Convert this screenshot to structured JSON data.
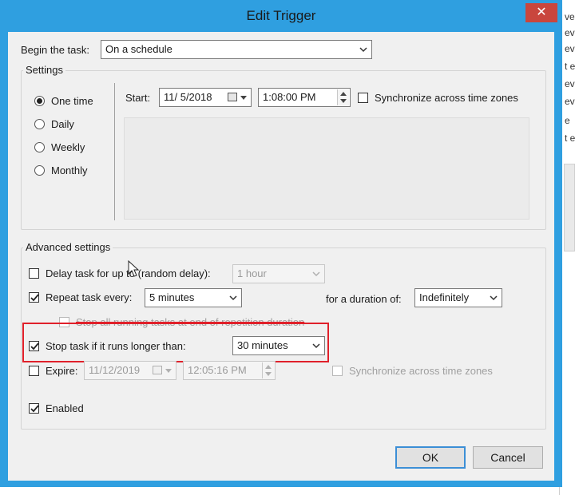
{
  "dialog": {
    "title": "Edit Trigger",
    "close_glyph": "✕"
  },
  "background_window": {
    "lines": [
      "ve",
      "eve",
      "eve",
      "t e",
      "eve",
      "eve",
      "e",
      "t e"
    ]
  },
  "begin_task": {
    "label": "Begin the task:",
    "value": "On a schedule"
  },
  "settings": {
    "group_label": "Settings",
    "radios": [
      {
        "label": "One time",
        "checked": true
      },
      {
        "label": "Daily",
        "checked": false
      },
      {
        "label": "Weekly",
        "checked": false
      },
      {
        "label": "Monthly",
        "checked": false
      }
    ],
    "start_label": "Start:",
    "start_date": "11/  5/2018",
    "start_time": "1:08:00 PM",
    "sync_timezones_label": "Synchronize across time zones",
    "sync_timezones_checked": false
  },
  "advanced": {
    "group_label": "Advanced settings",
    "delay": {
      "label": "Delay task for up to (random delay):",
      "checked": false,
      "value": "1 hour",
      "enabled": false
    },
    "repeat": {
      "label": "Repeat task every:",
      "checked": true,
      "value": "5 minutes"
    },
    "duration": {
      "label": "for a duration of:",
      "value": "Indefinitely"
    },
    "stop_all": {
      "label": "Stop all running tasks at end of repetition duration",
      "checked": false,
      "enabled": false
    },
    "stop_longer": {
      "label": "Stop task if it runs longer than:",
      "checked": true,
      "value": "30 minutes"
    },
    "expire": {
      "label": "Expire:",
      "checked": false,
      "date": "11/12/2019",
      "time": "12:05:16 PM",
      "sync_label": "Synchronize across time zones",
      "sync_checked": false
    },
    "enabled": {
      "label": "Enabled",
      "checked": true
    }
  },
  "buttons": {
    "ok": "OK",
    "cancel": "Cancel"
  },
  "colors": {
    "titlebar": "#2f9fe0",
    "close_button": "#c9463d",
    "highlight": "#e0202a"
  }
}
